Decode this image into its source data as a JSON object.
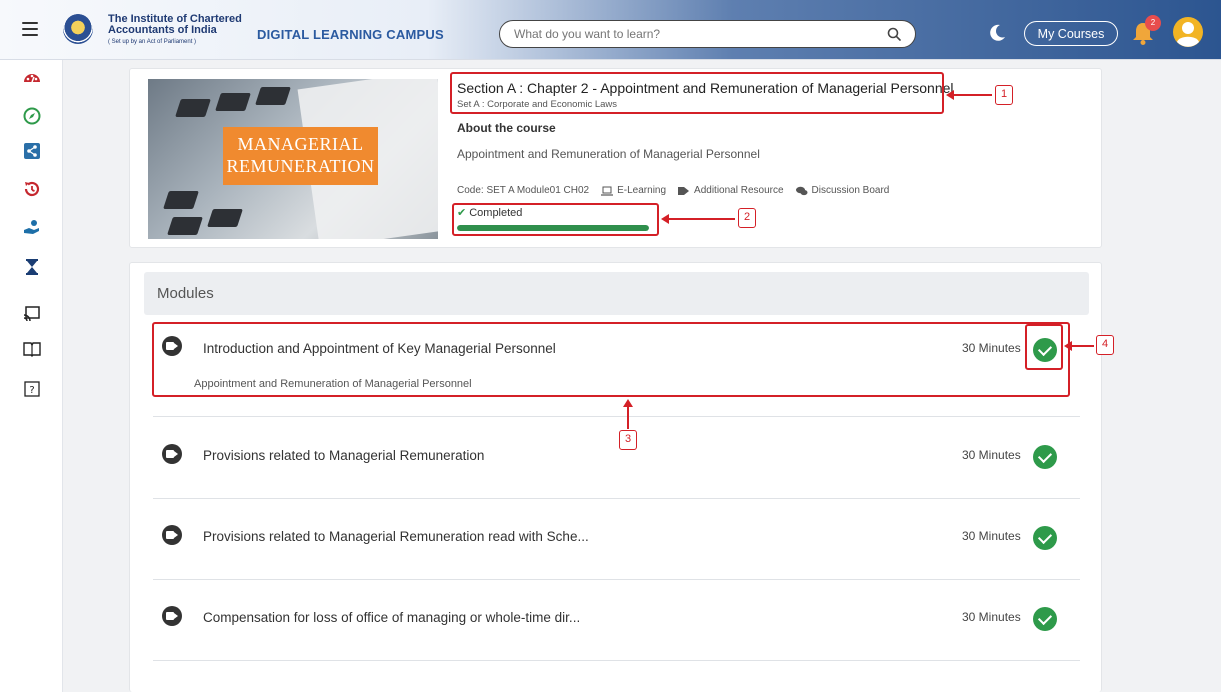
{
  "header": {
    "logo_line1": "The Institute of Chartered",
    "logo_line2": "Accountants of India",
    "logo_line3": "( Set up by an Act of Parliament )",
    "campus_title": "DIGITAL LEARNING CAMPUS",
    "search_placeholder": "What do you want to learn?",
    "my_courses_label": "My Courses",
    "notification_count": "2"
  },
  "sidebar": {
    "items": [
      {
        "icon": "dashboard-icon"
      },
      {
        "icon": "compass-icon"
      },
      {
        "icon": "share-icon"
      },
      {
        "icon": "history-icon"
      },
      {
        "icon": "hand-receive-icon"
      },
      {
        "icon": "hourglass-icon"
      },
      {
        "icon": "cast-icon"
      },
      {
        "icon": "book-open-icon"
      },
      {
        "icon": "help-icon"
      }
    ]
  },
  "course": {
    "image_banner_line1": "MANAGERIAL",
    "image_banner_line2": "REMUNERATION",
    "title": "Section A : Chapter 2 - Appointment and Remuneration of Managerial Personnel",
    "subtitle": "Set A : Corporate and Economic Laws",
    "about_heading": "About the course",
    "about_text": "Appointment and Remuneration of Managerial Personnel",
    "code": "Code: SET A Module01 CH02",
    "resource_elearning": "E-Learning",
    "resource_additional": "Additional Resource",
    "resource_discussion": "Discussion Board",
    "status": "Completed",
    "progress": 1.0
  },
  "modules": {
    "heading": "Modules",
    "items": [
      {
        "title": "Introduction and Appointment of Key Managerial Personnel",
        "description": "Appointment and Remuneration of Managerial Personnel",
        "duration": "30 Minutes",
        "completed": true
      },
      {
        "title": "Provisions related to Managerial Remuneration",
        "duration": "30 Minutes",
        "completed": true
      },
      {
        "title": "Provisions related to Managerial Remuneration read with Sche...",
        "duration": "30 Minutes",
        "completed": true
      },
      {
        "title": "Compensation for loss of office of managing or whole-time dir...",
        "duration": "30 Minutes",
        "completed": true
      }
    ]
  },
  "annotations": {
    "n1": "1",
    "n2": "2",
    "n3": "3",
    "n4": "4"
  },
  "colors": {
    "accent_green": "#2e9a4a",
    "annotation_red": "#d42027",
    "banner_orange": "#f08a2f",
    "header_blue": "#2c5590"
  }
}
